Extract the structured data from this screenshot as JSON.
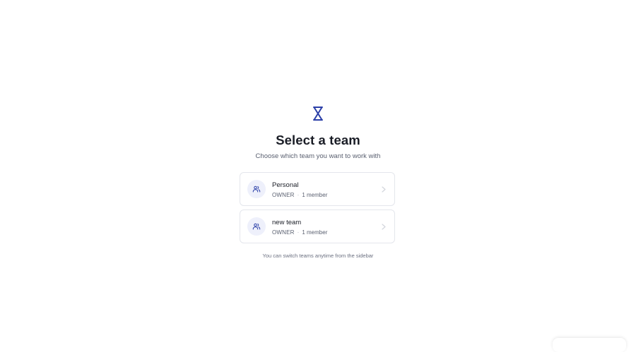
{
  "app": {
    "logo_icon": "hourglass-logo-icon",
    "accent_color": "#2b3fa8"
  },
  "header": {
    "title": "Select a team",
    "subtitle": "Choose which team you want to work with"
  },
  "teams": [
    {
      "name": "Personal",
      "role": "OWNER",
      "members": "1 member",
      "icon": "users-icon"
    },
    {
      "name": "new team",
      "role": "OWNER",
      "members": "1 member",
      "icon": "users-icon"
    }
  ],
  "footer": {
    "hint": "You can switch teams anytime from the sidebar"
  }
}
